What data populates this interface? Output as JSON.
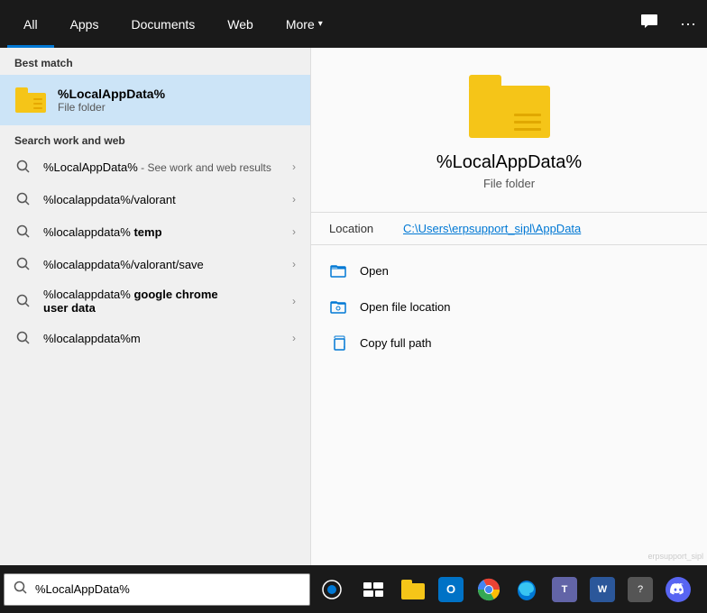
{
  "nav": {
    "tabs": [
      {
        "id": "all",
        "label": "All",
        "active": true
      },
      {
        "id": "apps",
        "label": "Apps"
      },
      {
        "id": "documents",
        "label": "Documents"
      },
      {
        "id": "web",
        "label": "Web"
      },
      {
        "id": "more",
        "label": "More",
        "hasArrow": true
      }
    ],
    "icons": {
      "feedback": "💬",
      "more": "···"
    }
  },
  "left": {
    "bestMatch": {
      "sectionLabel": "Best match",
      "name": "%LocalAppData%",
      "type": "File folder"
    },
    "searchWeb": {
      "sectionLabel": "Search work and web",
      "items": [
        {
          "text": "%LocalAppData%",
          "suffix": " - See work and web results",
          "bold": false
        },
        {
          "text": "%localappdata%/valorant",
          "bold": false
        },
        {
          "text": "%localappdata% temp",
          "boldPart": "temp",
          "mainText": "%localappdata% ",
          "boldText": "temp"
        },
        {
          "text": "%localappdata%/valorant/save",
          "bold": false
        },
        {
          "text": "%localappdata% google chrome user data",
          "mainText": "%localappdata% ",
          "boldText": "google chrome user data"
        },
        {
          "text": "%localappdata%m",
          "bold": false
        }
      ]
    }
  },
  "right": {
    "title": "%LocalAppData%",
    "subtitle": "File folder",
    "location": {
      "label": "Location",
      "path": "C:\\Users\\erpsupport_sipl\\AppData"
    },
    "actions": [
      {
        "id": "open",
        "label": "Open",
        "icon": "folder-open"
      },
      {
        "id": "open-file-location",
        "label": "Open file location",
        "icon": "folder-location"
      },
      {
        "id": "copy-full-path",
        "label": "Copy full path",
        "icon": "copy"
      }
    ]
  },
  "taskbar": {
    "searchText": "%LocalAppData%",
    "searchPlaceholder": "%LocalAppData%",
    "apps": [
      {
        "id": "cortana",
        "label": "Search",
        "color": "#0078d4"
      },
      {
        "id": "taskview",
        "label": "Task View"
      },
      {
        "id": "explorer",
        "label": "File Explorer",
        "color": "#f5c518"
      },
      {
        "id": "outlook",
        "label": "Outlook",
        "color": "#0072c6"
      },
      {
        "id": "chrome",
        "label": "Chrome",
        "color": "#4285f4"
      },
      {
        "id": "edge",
        "label": "Edge",
        "color": "#0078d4"
      },
      {
        "id": "teams",
        "label": "Teams",
        "color": "#6264a7"
      },
      {
        "id": "word",
        "label": "Word",
        "color": "#2b579a"
      },
      {
        "id": "unknown",
        "label": "Unknown"
      },
      {
        "id": "discord",
        "label": "Discord",
        "color": "#5865f2"
      }
    ]
  }
}
